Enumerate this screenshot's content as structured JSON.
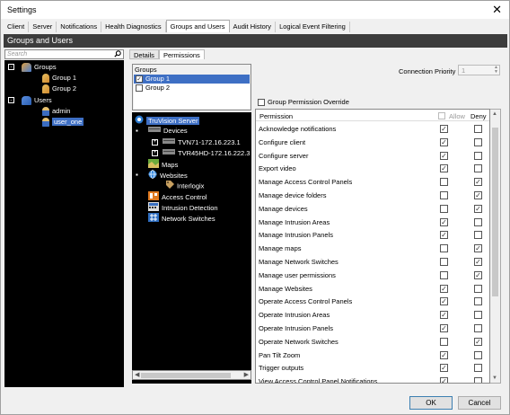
{
  "window": {
    "title": "Settings",
    "close_glyph": "✕"
  },
  "tabs": [
    "Client",
    "Server",
    "Notifications",
    "Health Diagnostics",
    "Groups and Users",
    "Audit History",
    "Logical Event Filtering"
  ],
  "active_tab": "Groups and Users",
  "header": {
    "title": "Groups and Users"
  },
  "search": {
    "placeholder": "Search",
    "icon": "search-icon"
  },
  "left_tree": {
    "groups": {
      "label": "Groups",
      "expander": "-",
      "items": [
        "Group 1",
        "Group 2"
      ]
    },
    "users": {
      "label": "Users",
      "expander": "-",
      "items": [
        "admin",
        "user_one"
      ],
      "selected": "user_one"
    }
  },
  "subtabs": [
    "Details",
    "Permissions"
  ],
  "active_subtab": "Permissions",
  "groups_panel": {
    "label": "Groups",
    "items": [
      {
        "label": "Group 1",
        "checked": true,
        "selected": true
      },
      {
        "label": "Group 2",
        "checked": false,
        "selected": false
      }
    ]
  },
  "device_tree": {
    "server": "TruVision Server",
    "devices": {
      "label": "Devices",
      "items": [
        "TVN71-172.16.223.1",
        "TVR45HD-172.16.222.3"
      ]
    },
    "maps": "Maps",
    "websites": {
      "label": "Websites",
      "items": [
        "Interlogix"
      ]
    },
    "access_control": "Access Control",
    "intrusion_detection": "Intrusion Detection",
    "network_switches": "Network Switches"
  },
  "connection_priority": {
    "label": "Connection Priority",
    "value": "1"
  },
  "override": {
    "label": "Group Permission Override",
    "checked": false
  },
  "permissions": {
    "headers": {
      "permission": "Permission",
      "allow": "Allow",
      "deny": "Deny"
    },
    "check_glyph": "✓",
    "rows": [
      {
        "name": "Acknowledge notifications",
        "allow": true,
        "deny": false
      },
      {
        "name": "Configure client",
        "allow": true,
        "deny": false
      },
      {
        "name": "Configure server",
        "allow": true,
        "deny": false
      },
      {
        "name": "Export video",
        "allow": true,
        "deny": false
      },
      {
        "name": "Manage Access Control Panels",
        "allow": false,
        "deny": true
      },
      {
        "name": "Manage device folders",
        "allow": false,
        "deny": true
      },
      {
        "name": "Manage devices",
        "allow": false,
        "deny": true
      },
      {
        "name": "Manage Intrusion Areas",
        "allow": true,
        "deny": false
      },
      {
        "name": "Manage Intrusion Panels",
        "allow": true,
        "deny": false
      },
      {
        "name": "Manage maps",
        "allow": false,
        "deny": true
      },
      {
        "name": "Manage Network Switches",
        "allow": false,
        "deny": true
      },
      {
        "name": "Manage user permissions",
        "allow": false,
        "deny": true
      },
      {
        "name": "Manage Websites",
        "allow": true,
        "deny": false
      },
      {
        "name": "Operate Access Control Panels",
        "allow": true,
        "deny": false
      },
      {
        "name": "Operate Intrusion Areas",
        "allow": true,
        "deny": false
      },
      {
        "name": "Operate Intrusion Panels",
        "allow": true,
        "deny": false
      },
      {
        "name": "Operate Network Switches",
        "allow": false,
        "deny": true
      },
      {
        "name": "Pan Tilt Zoom",
        "allow": true,
        "deny": false
      },
      {
        "name": "Trigger outputs",
        "allow": true,
        "deny": false
      },
      {
        "name": "View Access Control Panel Notifications",
        "allow": true,
        "deny": false
      }
    ]
  },
  "buttons": {
    "ok": "OK",
    "cancel": "Cancel"
  },
  "colors": {
    "selection": "#3e6fc4",
    "tree_bg": "#000000",
    "header_bg": "#3c3c3c"
  }
}
